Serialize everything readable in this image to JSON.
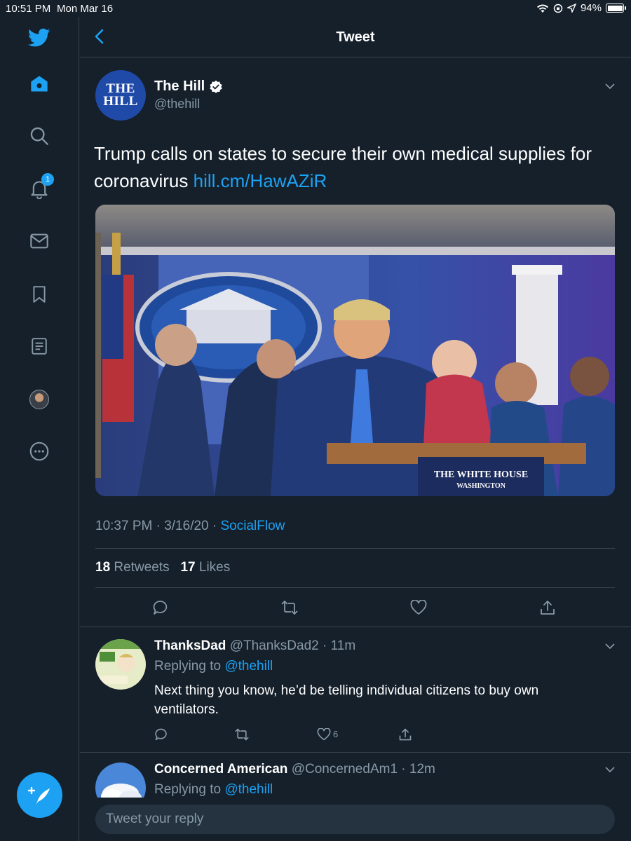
{
  "status_bar": {
    "time": "10:51 PM",
    "date": "Mon Mar 16",
    "battery": "94%"
  },
  "sidebar": {
    "notification_badge": "1",
    "items": [
      {
        "icon": "twitter-bird-icon"
      },
      {
        "icon": "home-icon"
      },
      {
        "icon": "search-icon"
      },
      {
        "icon": "bell-icon"
      },
      {
        "icon": "mail-icon"
      },
      {
        "icon": "bookmark-icon"
      },
      {
        "icon": "list-icon"
      },
      {
        "icon": "profile-avatar"
      },
      {
        "icon": "more-icon"
      }
    ]
  },
  "header": {
    "title": "Tweet"
  },
  "tweet": {
    "avatar_text_line1": "THE",
    "avatar_text_line2": "HILL",
    "author_name": "The Hill",
    "author_handle": "@thehill",
    "text": "Trump calls on states to secure their own medical supplies for coronavirus ",
    "link": "hill.cm/HawAZiR",
    "image_text_line1": "THE WHITE HOUSE",
    "image_text_line2": "WASHINGTON",
    "timestamp": "10:37 PM · 3/16/20 · ",
    "source": "SocialFlow",
    "retweets_count": "18",
    "retweets_label": "Retweets",
    "likes_count": "17",
    "likes_label": "Likes"
  },
  "replies": [
    {
      "name": "ThanksDad",
      "handle": "@ThanksDad2 · 11m",
      "replying_label": "Replying to ",
      "replying_to": "@thehill",
      "text": "Next thing you know, he’d be telling individual citizens to buy own ventilators.",
      "like_count": "6"
    },
    {
      "name": "Concerned American",
      "handle": "@ConcernedAm1 · 12m",
      "replying_label": "Replying to ",
      "replying_to": "@thehill"
    }
  ],
  "reply_bar": {
    "placeholder": "Tweet your reply"
  },
  "colors": {
    "accent": "#1da1f2",
    "background": "#15202b",
    "secondary_text": "#8899a6",
    "divider": "#38444d"
  }
}
